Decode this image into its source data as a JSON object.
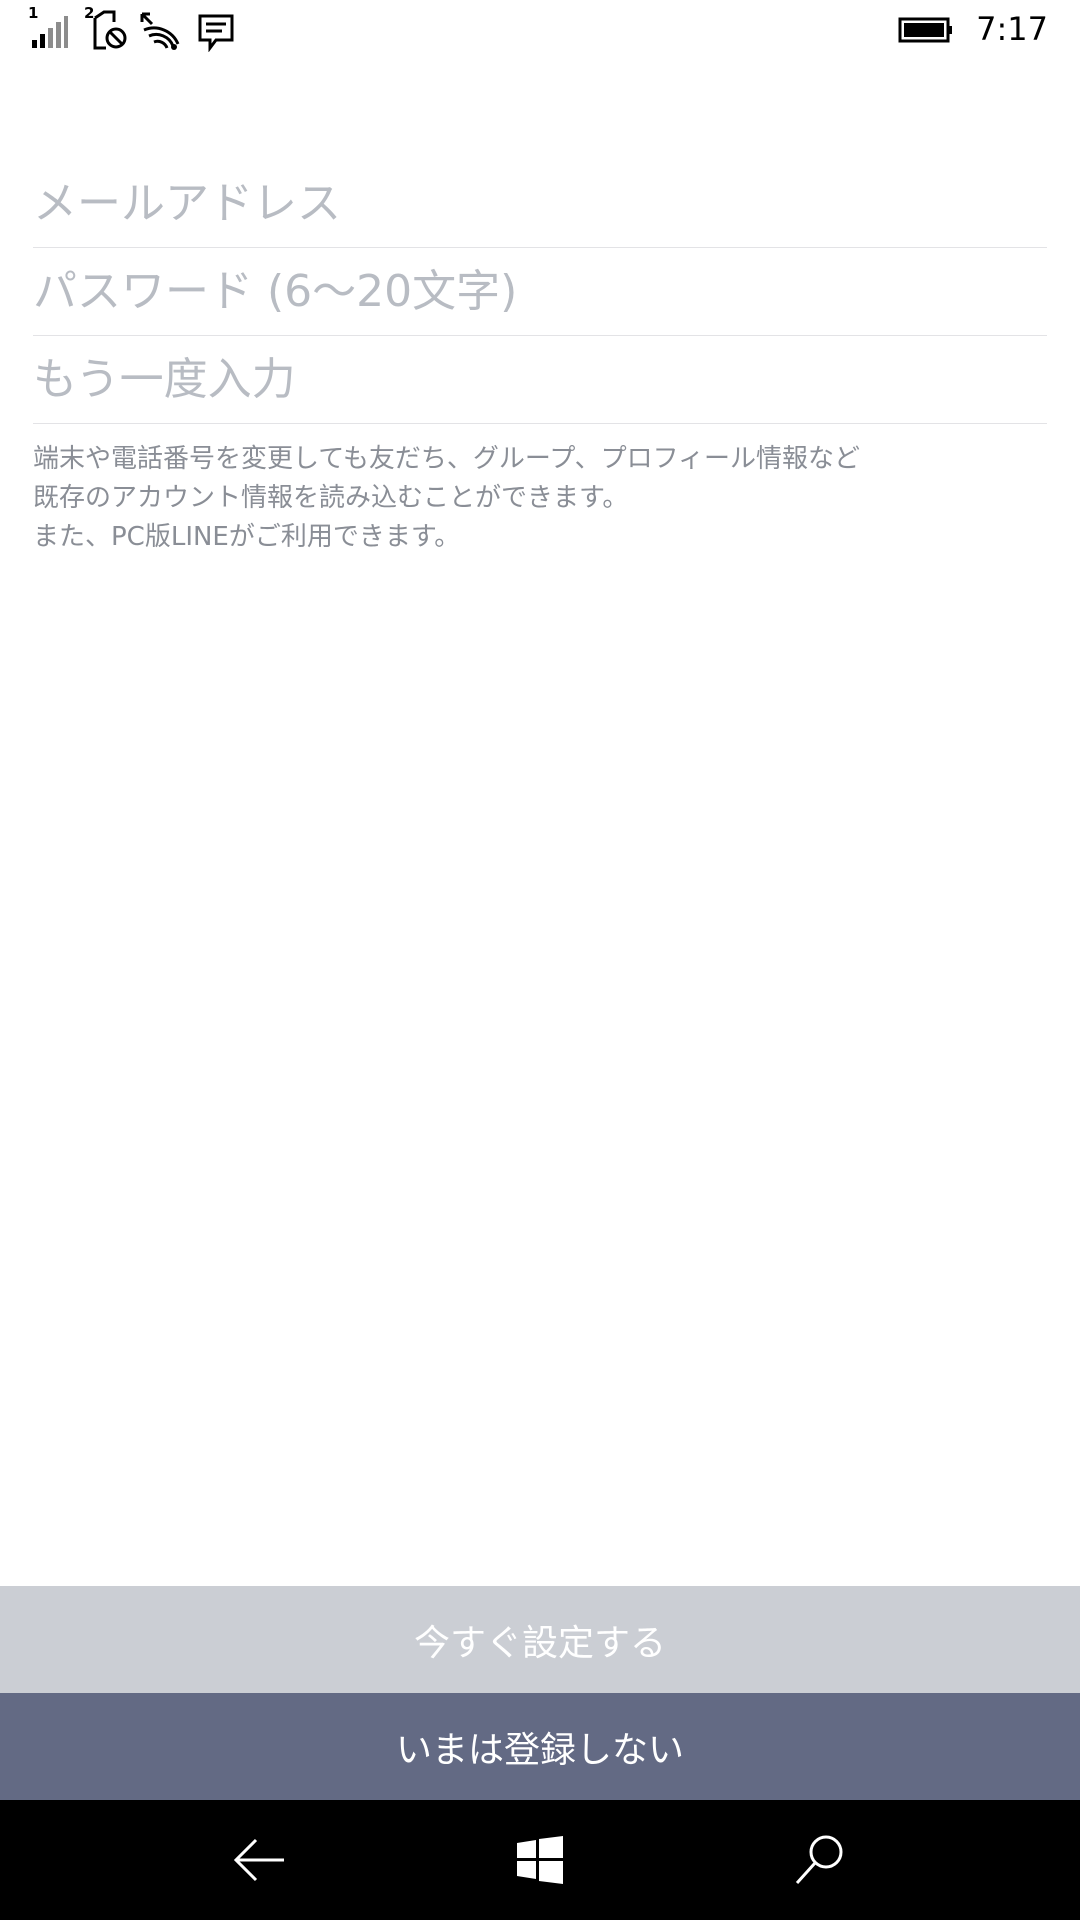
{
  "status_bar": {
    "sim1_label": "1",
    "sim2_label": "2",
    "time": "7:17",
    "icons": [
      "signal-bars-icon",
      "sim2-no-signal-icon",
      "wifi-icon",
      "message-notification-icon",
      "battery-icon"
    ]
  },
  "form": {
    "email_placeholder": "メールアドレス",
    "password_placeholder": "パスワード (6～20文字)",
    "confirm_placeholder": "もう一度入力"
  },
  "notice": {
    "line1": "端末や電話番号を変更しても友だち、グループ、プロフィール情報など",
    "line2": "既存のアカウント情報を読み込むことができます。",
    "line3": "また、PC版LINEがご利用できます。"
  },
  "buttons": {
    "setup_now": "今すぐ設定する",
    "skip": "いまは登録しない"
  },
  "colors": {
    "primary_button_bg": "#cbced4",
    "secondary_button_bg": "#636a84",
    "placeholder": "#b8bcc3",
    "notice_text": "#8a8e96",
    "nav_bar": "#000000"
  },
  "nav_bar": {
    "icons": [
      "back-arrow-icon",
      "windows-start-icon",
      "search-icon"
    ]
  }
}
